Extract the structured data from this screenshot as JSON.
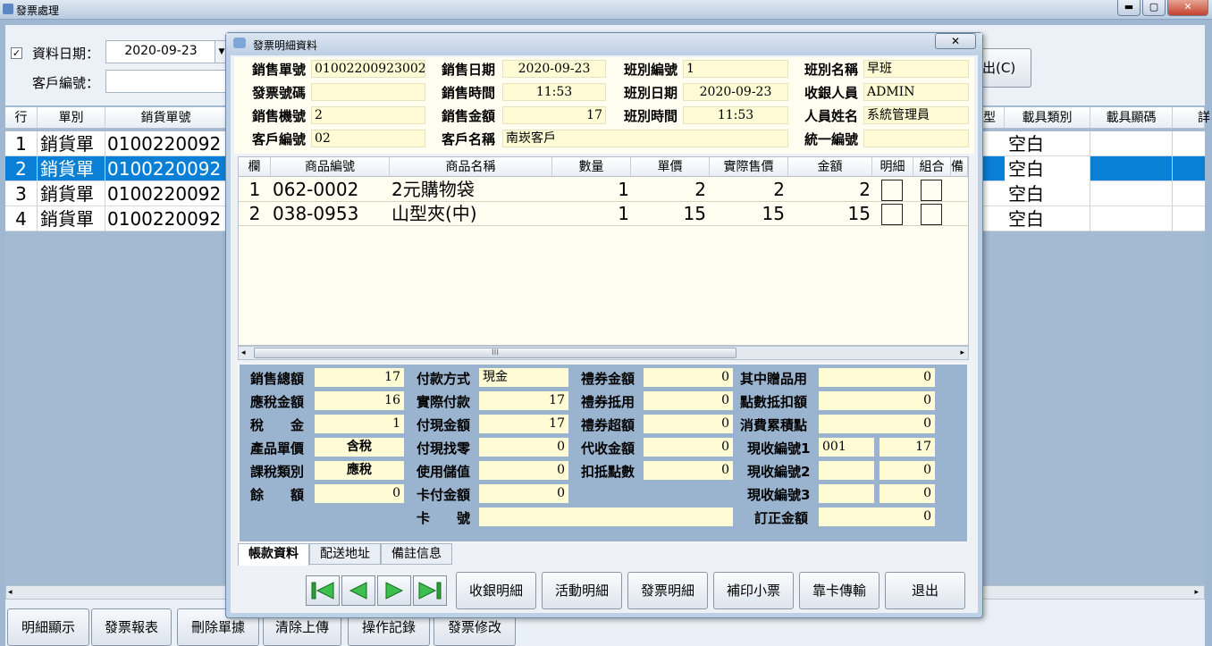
{
  "main": {
    "title": "發票處理",
    "min": "▬",
    "max": "▢",
    "close": "✕",
    "filter": {
      "date_label": "資料日期：",
      "date_value": "2020-09-23",
      "customer_label": "客戶編號：",
      "customer_value": "",
      "exit_fragment": "出(C)"
    },
    "grid": {
      "headers": [
        "行",
        "單別",
        "銷貨單號",
        "型",
        "載具類別",
        "載具顯碼",
        "詳"
      ],
      "rows": [
        {
          "n": "1",
          "type": "銷貨單",
          "no": "0100220092",
          "carrier": "空白"
        },
        {
          "n": "2",
          "type": "銷貨單",
          "no": "0100220092",
          "carrier": "空白"
        },
        {
          "n": "3",
          "type": "銷貨單",
          "no": "0100220092",
          "carrier": "空白"
        },
        {
          "n": "4",
          "type": "銷貨單",
          "no": "0100220092",
          "carrier": "空白"
        }
      ]
    },
    "bottom_buttons": [
      "明細顯示",
      "發票報表",
      "刪除單據",
      "清除上傳",
      "操作記錄",
      "發票修改"
    ]
  },
  "dialog": {
    "title": "發票明細資料",
    "close": "✕",
    "header": {
      "sale_no_label": "銷售單號",
      "sale_no": "01002200923002",
      "sale_date_label": "銷售日期",
      "sale_date": "2020-09-23",
      "shift_no_label": "班別編號",
      "shift_no": "1",
      "shift_name_label": "班別名稱",
      "shift_name": "早班",
      "invoice_no_label": "發票號碼",
      "invoice_no": "",
      "sale_time_label": "銷售時間",
      "sale_time": "11:53",
      "shift_date_label": "班別日期",
      "shift_date": "2020-09-23",
      "cashier_label": "收銀人員",
      "cashier": "ADMIN",
      "machine_label": "銷售機號",
      "machine": "2",
      "amount_label": "銷售金額",
      "amount": "17",
      "shift_time_label": "班別時間",
      "shift_time": "11:53",
      "staff_label": "人員姓名",
      "staff": "系統管理員",
      "cust_no_label": "客戶編號",
      "cust_no": "02",
      "cust_name_label": "客戶名稱",
      "cust_name": "南崁客戶",
      "unified_label": "統一編號",
      "unified": ""
    },
    "detail": {
      "headers": [
        "欄",
        "商品編號",
        "商品名稱",
        "數量",
        "單價",
        "實際售價",
        "金額",
        "明細",
        "組合",
        "備註"
      ],
      "rows": [
        {
          "n": "1",
          "code": "062-0002",
          "name": "2元購物袋",
          "qty": "1",
          "price": "2",
          "actual": "2",
          "amount": "2"
        },
        {
          "n": "2",
          "code": "038-0953",
          "name": "山型夾(中)",
          "qty": "1",
          "price": "15",
          "actual": "15",
          "amount": "15"
        }
      ],
      "scroll_grip": "III"
    },
    "payment": {
      "total_label": "銷售總額",
      "total": "17",
      "taxable_label": "應稅金額",
      "taxable": "16",
      "tax_label": "稅　　金",
      "tax": "1",
      "unit_price_label": "產品單價",
      "unit_price": "含稅",
      "tax_type_label": "課稅類別",
      "tax_type": "應稅",
      "balance_label": "餘　　額",
      "balance": "0",
      "pay_method_label": "付款方式",
      "pay_method": "現金",
      "actual_pay_label": "實際付款",
      "actual_pay": "17",
      "cash_pay_label": "付現金額",
      "cash_pay": "17",
      "change_label": "付現找零",
      "change": "0",
      "stored_label": "使用儲值",
      "stored": "0",
      "card_pay_label": "卡付金額",
      "card_pay": "0",
      "card_no_label": "卡　　號",
      "card_no": "",
      "voucher_label": "禮券金額",
      "voucher": "0",
      "voucher_used_label": "禮券抵用",
      "voucher_used": "0",
      "voucher_over_label": "禮券超額",
      "voucher_over": "0",
      "collect_label": "代收金額",
      "collect": "0",
      "points_deduct_label": "扣抵點數",
      "points_deduct": "0",
      "gift_label": "其中贈品用",
      "gift": "0",
      "points_amount_label": "點數抵扣額",
      "points_amount": "0",
      "accum_label": "消費累積點",
      "accum": "0",
      "cash_no1_label": "現收編號1",
      "cash_no1": "001",
      "cash_no1_amt": "17",
      "cash_no2_label": "現收編號2",
      "cash_no2": "",
      "cash_no2_amt": "0",
      "cash_no3_label": "現收編號3",
      "cash_no3": "",
      "cash_no3_amt": "0",
      "correction_label": "訂正金額",
      "correction": "0"
    },
    "tabs": [
      "帳款資料",
      "配送地址",
      "備註信息"
    ],
    "buttons": [
      "收銀明細",
      "活動明細",
      "發票明細",
      "補印小票",
      "靠卡傳輸",
      "退出"
    ]
  },
  "colors": {
    "selected_row": "#0a7fd6",
    "field_bg": "#fffbd5",
    "panel_bg": "#9ab4cf"
  }
}
